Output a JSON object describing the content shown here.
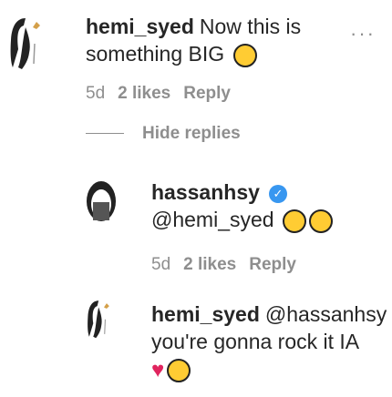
{
  "comment1": {
    "username": "hemi_syed",
    "text": "Now this is something BIG",
    "emoji": "smile-emoji",
    "time": "5d",
    "likes": "2 likes",
    "reply_label": "Reply"
  },
  "more_label": "···",
  "replies": {
    "hide_label": "Hide replies"
  },
  "reply1": {
    "username": "hassanhsy",
    "mention": "@hemi_syed",
    "time": "5d",
    "likes": "2 likes",
    "reply_label": "Reply"
  },
  "reply2": {
    "username": "hemi_syed",
    "mention": "@hassanhsy",
    "text": "you're gonna rock it IA"
  },
  "colors": {
    "verified": "#3897f0",
    "heart": "#e0245e"
  }
}
